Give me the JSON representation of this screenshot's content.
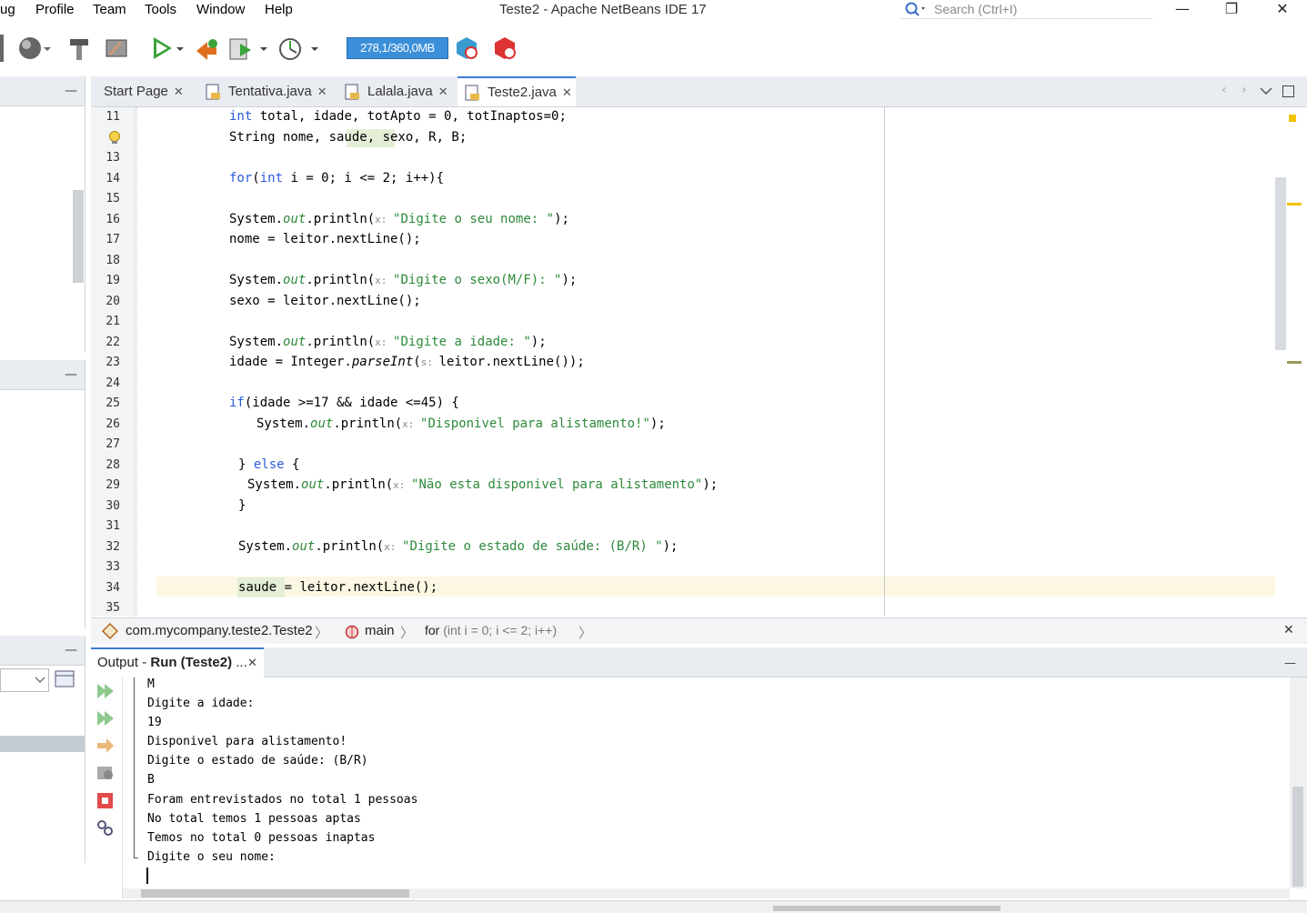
{
  "menu": [
    "ug",
    "Profile",
    "Team",
    "Tools",
    "Window",
    "Help"
  ],
  "window_title": "Teste2 - Apache NetBeans IDE 17",
  "search": {
    "placeholder": "Search (Ctrl+I)"
  },
  "window_controls": {
    "minimize": "—",
    "restore": "❐",
    "close": "✕"
  },
  "toolbar": {
    "memory": "278,1/360,0MB"
  },
  "tabs": [
    {
      "label": "Start Page"
    },
    {
      "label": "Tentativa.java"
    },
    {
      "label": "Lalala.java"
    },
    {
      "label": "Teste2.java"
    }
  ],
  "code_lines": [
    {
      "n": "11"
    },
    {
      "n": "12"
    },
    {
      "n": "13"
    },
    {
      "n": "14"
    },
    {
      "n": "15"
    },
    {
      "n": "16"
    },
    {
      "n": "17"
    },
    {
      "n": "18"
    },
    {
      "n": "19"
    },
    {
      "n": "20"
    },
    {
      "n": "21"
    },
    {
      "n": "22"
    },
    {
      "n": "23"
    },
    {
      "n": "24"
    },
    {
      "n": "25"
    },
    {
      "n": "26"
    },
    {
      "n": "27"
    },
    {
      "n": "28"
    },
    {
      "n": "29"
    },
    {
      "n": "30"
    },
    {
      "n": "31"
    },
    {
      "n": "32"
    },
    {
      "n": "33"
    },
    {
      "n": "34"
    },
    {
      "n": "35"
    }
  ],
  "code": {
    "l11a": "int",
    "l11b": " total, idade, totApto = 0, totInaptos=0;",
    "l12": "String nome, saude, sexo, R, B;",
    "l14a": "for",
    "l14b": "(",
    "l14c": "int",
    "l14d": " i = 0; i <= 2; i++){",
    "l16a": "System.",
    "l16b": "out",
    "l16c": ".println(",
    "l16h": "x: ",
    "l16s": "\"Digite o seu nome: \"",
    "l16e": ");",
    "l17": "nome = leitor.nextLine();",
    "l19a": "System.",
    "l19b": "out",
    "l19c": ".println(",
    "l19h": "x: ",
    "l19s": "\"Digite o sexo(M/F): \"",
    "l19e": ");",
    "l20": "sexo = leitor.nextLine();",
    "l22a": "System.",
    "l22b": "out",
    "l22c": ".println(",
    "l22h": "x: ",
    "l22s": "\"Digite a idade: \"",
    "l22e": ");",
    "l23a": "idade = Integer.",
    "l23b": "parseInt",
    "l23c": "(",
    "l23h": "s: ",
    "l23d": "leitor.nextLine());",
    "l25a": "if",
    "l25b": "(idade >=17 && idade <=45) {",
    "l26a": "System.",
    "l26b": "out",
    "l26c": ".println(",
    "l26h": "x: ",
    "l26s": "\"Disponivel para alistamento!\"",
    "l26e": ");",
    "l28a": "} ",
    "l28b": "else",
    "l28c": " {",
    "l29a": "System.",
    "l29b": "out",
    "l29c": ".println(",
    "l29h": "x: ",
    "l29s": "\"Não esta disponivel para alistamento\"",
    "l29e": ");",
    "l30": "}",
    "l32a": "System.",
    "l32b": "out",
    "l32c": ".println(",
    "l32h": "x: ",
    "l32s": "\"Digite o estado de saúde: (B/R) \"",
    "l32e": ");",
    "l34a": "saude",
    "l34b": " = leitor.nextLine();"
  },
  "breadcrumb": {
    "class": "com.mycompany.teste2.Teste2",
    "method": "main",
    "loop_kw": "for",
    "loop_rest": " (int i = 0; i <= 2; i++)"
  },
  "output": {
    "tab_prefix": "Output - ",
    "tab_bold": "Run (Teste2)",
    "tab_suffix": " ...",
    "lines": [
      "M",
      "Digite a idade:",
      "19",
      "Disponivel para alistamento!",
      "Digite o estado de saúde: (B/R)",
      "B",
      "Foram entrevistados no total 1 pessoas",
      "No total temos 1 pessoas aptas",
      "Temos no total 0 pessoas inaptas",
      "Digite o seu nome:"
    ]
  },
  "colors": {
    "accent": "#3a7bd5",
    "keyword": "#2a5cd9",
    "string": "#2d8a3a",
    "memory_bar": "#3b8fd9"
  }
}
